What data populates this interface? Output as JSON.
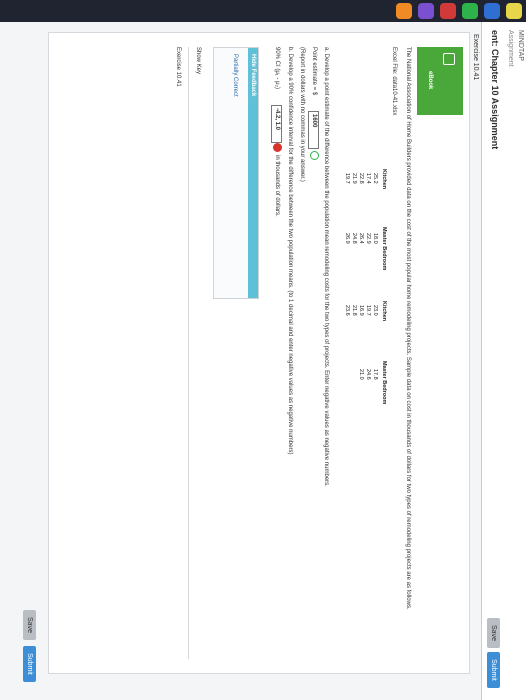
{
  "window": {
    "top_title": "MINDTAP"
  },
  "header": {
    "assignment_small": "Assignment",
    "assignment_title": "ent: Chapter 10 Assignment",
    "save_label": "Save",
    "submit_label": "Submit"
  },
  "exercise": {
    "title": "Exercise 10.41",
    "ebook_label": "eBook",
    "intro": "The National Association of Home Builders provided data on the cost of the most popular home remodeling projects. Sample data on cost in thousands of dollars for two types of remodeling projects are as follows.",
    "excel_file": "Excel File: data10-41.xlsx",
    "table": {
      "headers": [
        "Kitchen",
        "Master Bedroom",
        "Kitchen",
        "Master Bedroom"
      ],
      "columns": [
        [
          "25.2",
          "17.4",
          "22.8",
          "21.9",
          "19.7"
        ],
        [
          "18.0",
          "22.9",
          "26.4",
          "24.8",
          "26.9"
        ],
        [
          "23.0",
          "19.7",
          "16.9",
          "21.8",
          "23.6"
        ],
        [
          "17.8",
          "24.6",
          "21.0",
          "",
          ""
        ]
      ]
    },
    "part_a": "a. Develop a point estimate of the difference between the population mean remodeling costs for the two types of projects. Enter negative values as negative numbers.",
    "point_estimate_label": "Point estimate = $",
    "point_estimate_value": "1600",
    "report_note": "(Report in dollars with no commas in your answer.)",
    "part_b": "b. Develop a 90% confidence interval for the difference between the two population means. (to 1 decimal and enter negative values as negative numbers)",
    "ci_label": "90% CI (μ₁ - μ₂)",
    "ci_value": "-4.2, 1.0",
    "ci_unit": "in thousands of dollars.",
    "feedback_header": "Hide Feedback",
    "feedback_status": "Partially Correct",
    "show_key": "Show Key",
    "footer_exercise": "Exercise 10.41"
  },
  "colors": {
    "accent_green": "#4aa83a",
    "feedback_blue": "#5fc0d8",
    "button_blue": "#3c8fd6"
  }
}
